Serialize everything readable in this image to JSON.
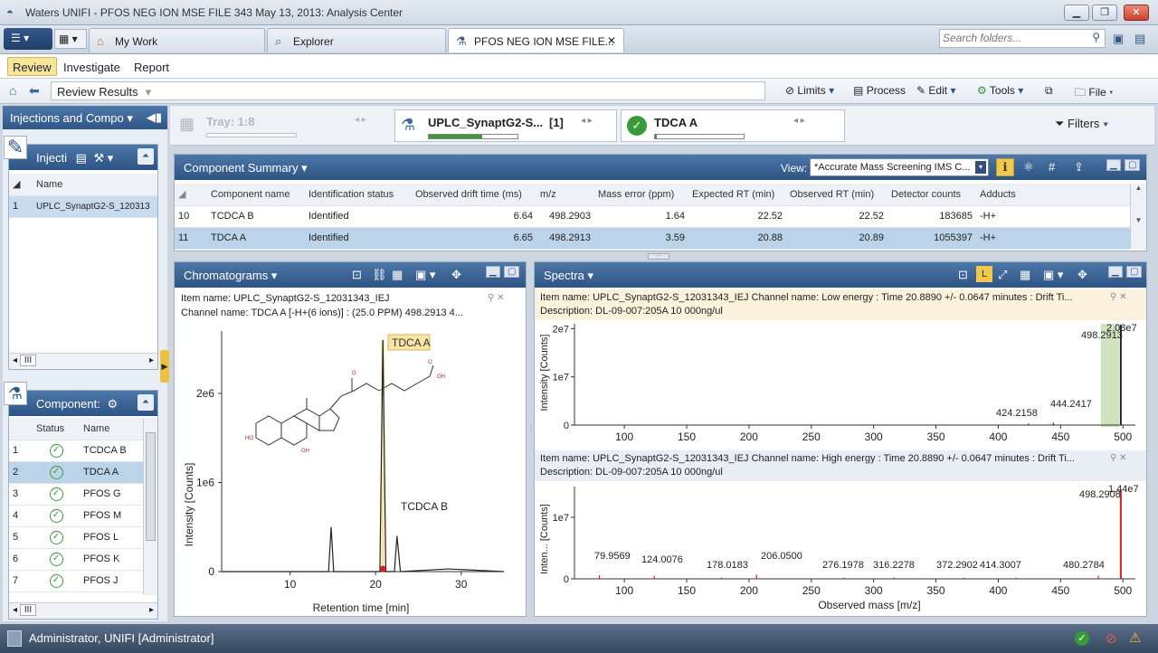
{
  "window": {
    "title": "Waters UNIFI - PFOS NEG ION MSE FILE 343 May 13, 2013: Analysis Center"
  },
  "tabs": {
    "my_work": "My Work",
    "explorer": "Explorer",
    "file": "PFOS NEG ION MSE FILE...",
    "search_placeholder": "Search folders..."
  },
  "ribbon": {
    "review": "Review",
    "investigate": "Investigate",
    "report": "Report"
  },
  "nav": {
    "review_results": "Review Results",
    "limits": "Limits",
    "process": "Process",
    "edit": "Edit",
    "tools": "Tools",
    "file": "File",
    "filters": "Filters"
  },
  "left": {
    "section": "Injections and Compo",
    "injections_title": "Injecti",
    "col_name": "Name",
    "injections": [
      {
        "num": "1",
        "name": "UPLC_SynaptG2-S_120313"
      }
    ],
    "components_title": "Component:",
    "col_status": "Status",
    "components": [
      {
        "num": "1",
        "name": "TCDCA B"
      },
      {
        "num": "2",
        "name": "TDCA A"
      },
      {
        "num": "3",
        "name": "PFOS G"
      },
      {
        "num": "4",
        "name": "PFOS M"
      },
      {
        "num": "5",
        "name": "PFOS L"
      },
      {
        "num": "6",
        "name": "PFOS K"
      },
      {
        "num": "7",
        "name": "PFOS J"
      }
    ],
    "scroll_label": "III"
  },
  "tray": {
    "tray_label": "Tray: 1:8",
    "injection": "UPLC_SynaptG2-S...",
    "injection_count": "[1]",
    "component": "TDCA A",
    "injection_progress": 0.6,
    "component_progress": 0.02
  },
  "summary": {
    "title": "Component Summary",
    "view_label": "View:",
    "view_value": "*Accurate Mass Screening IMS C...",
    "columns": [
      "Component name",
      "Identification status",
      "Observed drift time (ms)",
      "m/z",
      "Mass error (ppm)",
      "Expected RT (min)",
      "Observed RT (min)",
      "Detector counts",
      "Adducts"
    ],
    "rows": [
      {
        "num": "10",
        "cells": [
          "TCDCA B",
          "Identified",
          "6.64",
          "498.2903",
          "1.64",
          "22.52",
          "22.52",
          "183685",
          "-H+"
        ]
      },
      {
        "num": "11",
        "cells": [
          "TDCA A",
          "Identified",
          "6.65",
          "498.2913",
          "3.59",
          "20.88",
          "20.89",
          "1055397",
          "-H+"
        ]
      }
    ]
  },
  "chrom": {
    "title": "Chromatograms",
    "item_name": "Item name: UPLC_SynaptG2-S_12031343_IEJ",
    "channel": "Channel name: TDCA A [-H+(6 ions)] : (25.0 PPM) 498.2913 4...",
    "peak_label": "TDCA A",
    "peak2_label": "TCDCA B",
    "ylabel": "Intensity [Counts]",
    "xlabel": "Retention time [min]",
    "yticks": [
      "0",
      "1e6",
      "2e6"
    ],
    "xticks": [
      "10",
      "20",
      "30"
    ]
  },
  "spectra": {
    "title": "Spectra",
    "low_item": "Item name: UPLC_SynaptG2-S_12031343_IEJ   Channel name: Low energy : Time 20.8890 +/- 0.0647 minutes : Drift Ti...",
    "low_desc": "Description: DL-09-007:205A 10 000ng/ul",
    "low_ylabel": "Intensity [Counts]",
    "low_yticks": [
      "0",
      "1e7",
      "2e7"
    ],
    "low_peaks": [
      {
        "label": "424.2158"
      },
      {
        "label": "444.2417"
      },
      {
        "label": "498.2913"
      },
      {
        "label": "2.08e7"
      }
    ],
    "high_item": "Item name: UPLC_SynaptG2-S_12031343_IEJ  Channel name: High energy : Time 20.8890 +/- 0.0647 minutes : Drift Ti...",
    "high_desc": "Description: DL-09-007:205A 10 000ng/ul",
    "high_ylabel": "Inten... [Counts]",
    "high_yticks": [
      "0",
      "1e7"
    ],
    "high_labels": [
      "79.9569",
      "124.0076",
      "178.0183",
      "206.0500",
      "276.1978",
      "316.2278",
      "372.2902",
      "414.3007",
      "480.2784",
      "498.2908",
      "1.44e7"
    ],
    "xticks": [
      "100",
      "150",
      "200",
      "250",
      "300",
      "350",
      "400",
      "450",
      "500"
    ],
    "xlabel": "Observed mass [m/z]"
  },
  "chart_data": [
    {
      "type": "line",
      "title": "",
      "xlabel": "Retention time [min]",
      "ylabel": "Intensity [Counts]",
      "xlim": [
        2,
        35
      ],
      "ylim": [
        0,
        2700000
      ],
      "series": [
        {
          "x": [
            2,
            14.5,
            14.8,
            15.1,
            20.5,
            20.85,
            21.2,
            22.2,
            22.5,
            22.9,
            28.5,
            35
          ],
          "y": [
            0,
            0,
            500000,
            0,
            0,
            2600000,
            0,
            0,
            400000,
            0,
            30000,
            0
          ]
        }
      ]
    },
    {
      "type": "bar",
      "title": "",
      "xlabel": "Observed mass [m/z]",
      "ylabel": "Intensity [Counts]",
      "xlim": [
        60,
        510
      ],
      "ylim": [
        0,
        21000000
      ],
      "series": [
        {
          "x": [
            424.2158,
            444.2417,
            498.2913
          ],
          "values": [
            300000,
            500000,
            20800000
          ]
        }
      ]
    },
    {
      "type": "bar",
      "title": "",
      "xlabel": "Observed mass [m/z]",
      "ylabel": "Inten... [Counts]",
      "xlim": [
        60,
        510
      ],
      "ylim": [
        0,
        15000000
      ],
      "series": [
        {
          "x": [
            79.9569,
            124.0076,
            178.0183,
            206.05,
            276.1978,
            316.2278,
            372.2902,
            414.3007,
            480.2784,
            498.2908
          ],
          "values": [
            600000,
            500000,
            200000,
            700000,
            200000,
            200000,
            200000,
            200000,
            500000,
            14400000
          ]
        }
      ]
    }
  ],
  "status": {
    "user": "Administrator, UNIFI [Administrator]"
  },
  "colors": {
    "header_blue": "#2f5687",
    "selected_row": "#bcd4ea",
    "peak_green": "#3a9a3a",
    "peak_red": "#cc2222"
  }
}
